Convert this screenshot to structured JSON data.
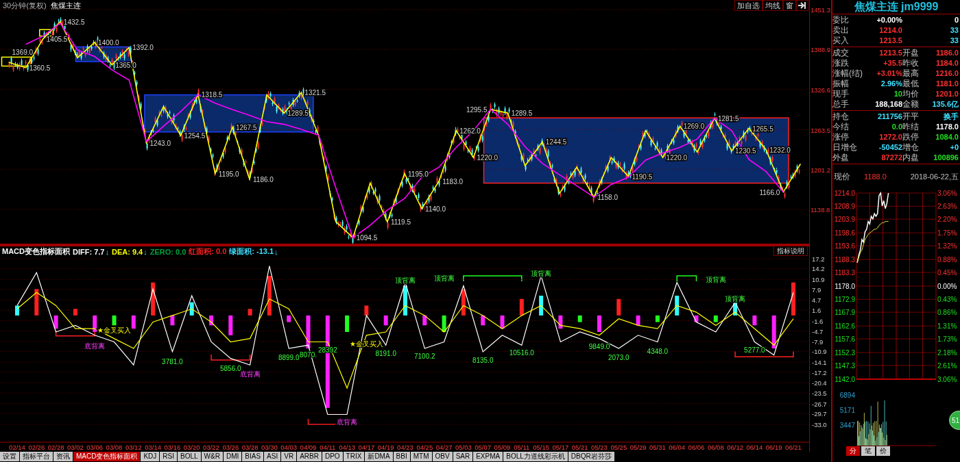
{
  "main_chart": {
    "title": "30分钟(复权)",
    "symbol": "焦煤主连",
    "buttons": [
      "加自选",
      "均线",
      "窗"
    ],
    "chart_data": {
      "type": "line",
      "grid": true,
      "categories": [
        null,
        null,
        null,
        null,
        null,
        null,
        null,
        null,
        null,
        null,
        null,
        null,
        null,
        null,
        null,
        null,
        null,
        null,
        null,
        null,
        null,
        null,
        null,
        null,
        null,
        null,
        null,
        null,
        null,
        null,
        null,
        null,
        null,
        null,
        null,
        null,
        null,
        null,
        null,
        null,
        null,
        null,
        null,
        null,
        null,
        null,
        null
      ],
      "ylim": [
        1083.2,
        1466.3
      ],
      "yticks": [
        {
          "value": 1451.3,
          "label": "1451.3"
        },
        {
          "value": 1388.9,
          "label": "1388.9"
        },
        {
          "value": 1326.6,
          "label": "1326.6"
        },
        {
          "value": 1263.5,
          "label": "1263.5"
        },
        {
          "value": 1201.2,
          "label": "1201.2"
        },
        {
          "value": 1138.8,
          "label": "1138.8"
        }
      ],
      "series": [
        {
          "color": "#ffff00",
          "values": [
            1369,
            1360.5,
            1405.5,
            1432.5,
            1376,
            1400,
            1365,
            1392,
            1243,
            1300,
            1254.5,
            1318.5,
            1195,
            1267.5,
            1186,
            1318,
            1289.5,
            1321.5,
            1255,
            1120,
            1094.5,
            1180,
            1119.5,
            1195,
            1140,
            1183,
            1262,
            1220,
            1295.5,
            1289.5,
            1207,
            1244.5,
            1164,
            1205,
            1158,
            1220,
            1190.5,
            1262,
            1220,
            1269,
            1228.5,
            1281.5,
            1230.5,
            1265.5,
            1232,
            1166,
            1210
          ]
        },
        {
          "color": "#ff00ff",
          "values": [
            null,
            1397,
            1410,
            1430,
            1388,
            1378,
            1357,
            1341,
            1245,
            1269,
            1292,
            1318,
            1305,
            1295,
            1286,
            1276,
            1272,
            1264,
            1255,
            1173,
            1094.5,
            1114,
            1138,
            1156,
            1189,
            1205,
            1236,
            1262,
            1295.5,
            1272,
            1237,
            1211,
            1193,
            1176,
            1158,
            1178,
            1189,
            1216,
            1227,
            1236,
            1249,
            1281.5,
            1262,
            1217,
            1198,
            1166,
            null
          ]
        }
      ],
      "annotations": [
        "1360.5",
        "1369.0",
        "1405.5",
        "1432.5",
        "1400.0",
        "1392.0",
        "1365.0",
        "1318.5",
        "1243.0",
        "1254.5",
        "1267.5",
        "1195.0",
        "1186.0",
        "1321.5",
        "1289.5",
        "1094.5",
        "1119.5",
        "1195.0",
        "1140.0",
        "1183.0",
        "1262.0",
        "1220.0",
        "1295.5",
        "1289.5",
        "1244.5",
        "1158.0",
        "1190.5",
        "1220.0",
        "1269.0",
        "1281.5",
        "1230.5",
        "1265.5",
        "1232.0",
        "1166.0"
      ]
    }
  },
  "macd": {
    "title": "MACD变色指标面积",
    "button": "指标说明",
    "readouts": [
      {
        "text": "DIFF: 7.7",
        "arrow": "↓",
        "color": "#ffffff"
      },
      {
        "text": "DEA: 9.4",
        "arrow": "↓",
        "color": "#ffff00"
      },
      {
        "text": "ZERO: 0.0",
        "color": "#00a040"
      },
      {
        "text": "红面积: 0.0",
        "color": "#ff2020"
      },
      {
        "text": "绿面积: -13.1",
        "arrow": "↓",
        "color": "#40e0ff"
      }
    ],
    "chart_data": {
      "type": "bar",
      "grid": true,
      "categories": [
        "02/14",
        "02/26",
        "02/28",
        "03/02",
        "03/06",
        "03/08",
        "03/12",
        "03/14",
        "03/16",
        "03/20",
        "03/22",
        "03/26",
        "03/28",
        "03/30",
        "04/03",
        "04/09",
        "04/11",
        "04/13",
        "04/17",
        "04/19",
        "04/23",
        "04/25",
        "04/27",
        "05/03",
        "05/07",
        "05/09",
        "05/11",
        "05/15",
        "05/17",
        "05/21",
        "05/23",
        "05/25",
        "05/29",
        "05/31",
        "06/04",
        "06/06",
        "06/08",
        "06/12",
        "06/14",
        "06/19",
        "06/21"
      ],
      "ylim": [
        -38.4,
        21.35
      ],
      "yticks": [
        {
          "value": 17.2,
          "label": "17.2"
        },
        {
          "value": 14.2,
          "label": "14.2"
        },
        {
          "value": 10.9,
          "label": "10.9"
        },
        {
          "value": 7.9,
          "label": "7.9"
        },
        {
          "value": 4.7,
          "label": "4.7"
        },
        {
          "value": 1.6,
          "label": "1.6"
        },
        {
          "value": -1.6,
          "label": "-1.6"
        },
        {
          "value": -4.7,
          "label": "-4.7"
        },
        {
          "value": -7.9,
          "label": "-7.9"
        },
        {
          "value": -10.9,
          "label": "-10.9"
        },
        {
          "value": -14.1,
          "label": "-14.1"
        },
        {
          "value": -17.2,
          "label": "-17.2"
        },
        {
          "value": -20.4,
          "label": "-20.4"
        },
        {
          "value": -23.5,
          "label": "-23.5"
        },
        {
          "value": -26.7,
          "label": "-26.7"
        },
        {
          "value": -29.7,
          "label": "-29.7"
        },
        {
          "value": -33.0,
          "label": "-33.0"
        }
      ],
      "series": [
        {
          "type": "bar",
          "values": [
            3,
            8,
            -4,
            2,
            -5,
            -3,
            -4,
            10,
            -3,
            4,
            -3,
            -6,
            2,
            12,
            -2,
            -10,
            -28,
            -5,
            3,
            -3,
            9,
            -3,
            -5,
            8,
            -3,
            -4,
            5,
            6,
            -4,
            -2,
            -5,
            5,
            -3,
            -2,
            6,
            -2,
            -2,
            4,
            -3,
            -10,
            10
          ],
          "colors": [
            "#30ffff",
            "#ff2020",
            "#ff20ff",
            "#ff2020",
            "#ff20ff",
            "#20ff20",
            "#ff20ff",
            "#ff2020",
            "#ff20ff",
            "#30ffff",
            "#ff20ff",
            "#ff20ff",
            "#ff2020",
            "#ff2020",
            "#ff20ff",
            "#ff20ff",
            "#ff20ff",
            "#20ff20",
            "#ff2020",
            "#ff20ff",
            "#30ffff",
            "#ff20ff",
            "#20ff20",
            "#ff2020",
            "#ff20ff",
            "#ff20ff",
            "#ff2020",
            "#30ffff",
            "#ff20ff",
            "#20ff20",
            "#ff20ff",
            "#ff2020",
            "#ff20ff",
            "#20ff20",
            "#30ffff",
            "#ff20ff",
            "#20ff20",
            "#30ffff",
            "#ff20ff",
            "#ff20ff",
            "#ff2020"
          ]
        },
        {
          "type": "line",
          "color": "#ffffff",
          "values": [
            3,
            13,
            -5,
            -3,
            -6,
            -8,
            -15,
            8,
            -11,
            6,
            -8,
            -13,
            -15,
            15,
            -10,
            -9,
            -30,
            -30,
            0,
            -9,
            10,
            -10,
            -8,
            9,
            -11,
            -6,
            -9,
            12,
            -8,
            -5,
            -7,
            -10,
            -6,
            -8,
            10,
            -2,
            -5,
            4,
            -8,
            -12,
            7
          ]
        },
        {
          "type": "line",
          "color": "#ffff00",
          "values": [
            2,
            7,
            3,
            -4,
            -4,
            -7,
            -10,
            -2,
            0,
            2,
            -2,
            -8,
            -7,
            5,
            2,
            -8,
            -8,
            -22,
            -6,
            -5,
            3,
            0,
            -5,
            3,
            0,
            -4,
            0,
            3,
            -3,
            -4,
            -6,
            -1,
            -3,
            -4,
            3,
            1,
            -3,
            1,
            -4,
            -9,
            -1
          ]
        }
      ],
      "annotations": [
        "★金叉买入",
        "底背离",
        "3781.0",
        "5856.0",
        "底背离",
        "8899.0",
        "8070.",
        "28392",
        "底背离",
        "★金叉买入",
        "8191.0",
        "7100.2",
        "8135.0",
        "10516.0",
        "9849.0",
        "2073.0",
        "4348.0",
        "5277.0",
        "顶背离",
        "顶背离",
        "顶背离",
        "顶背离",
        "顶背离"
      ]
    }
  },
  "tabs": [
    {
      "label": "设置",
      "selected": false
    },
    {
      "label": "指标平台",
      "selected": false
    },
    {
      "label": "资讯",
      "selected": false
    },
    {
      "label": "MACD变色指标面积",
      "selected": true
    },
    {
      "label": "KDJ",
      "selected": false
    },
    {
      "label": "RSI",
      "selected": false
    },
    {
      "label": "BOLL",
      "selected": false
    },
    {
      "label": "W&R",
      "selected": false
    },
    {
      "label": "DMI",
      "selected": false
    },
    {
      "label": "BIAS",
      "selected": false
    },
    {
      "label": "ASI",
      "selected": false
    },
    {
      "label": "VR",
      "selected": false
    },
    {
      "label": "ARBR",
      "selected": false
    },
    {
      "label": "DPO",
      "selected": false
    },
    {
      "label": "TRIX",
      "selected": false
    },
    {
      "label": "新DMA",
      "selected": false
    },
    {
      "label": "BBI",
      "selected": false
    },
    {
      "label": "MTM",
      "selected": false
    },
    {
      "label": "OBV",
      "selected": false
    },
    {
      "label": "SAR",
      "selected": false
    },
    {
      "label": "EXPMA",
      "selected": false
    },
    {
      "label": "BOLL力道线彩示机",
      "selected": false
    },
    {
      "label": "DBQR岩芬莎",
      "selected": false
    }
  ],
  "quote": {
    "title": "焦煤主连 jm9999",
    "sections": [
      [
        {
          "label": "委比",
          "value": {
            "text": "+0.00%",
            "color": "#ffffff"
          },
          "value2": {
            "text": "0",
            "color": "#ffffff"
          }
        },
        {
          "label": "卖出",
          "value": {
            "text": "1214.0",
            "color": "#ff3030"
          },
          "value2": {
            "text": "33",
            "color": "#40e0ff"
          }
        },
        {
          "label": "买入",
          "value": {
            "text": "1213.5",
            "color": "#ff3030"
          },
          "value2": {
            "text": "33",
            "color": "#40e0ff"
          }
        }
      ],
      [
        {
          "label": "成交",
          "value": {
            "text": "1213.5",
            "color": "#ff3030"
          },
          "label2": "开盘",
          "value2": {
            "text": "1186.0",
            "color": "#ff3030"
          }
        },
        {
          "label": "涨跌",
          "value": {
            "text": "+35.5",
            "color": "#ff3030"
          },
          "label2": "昨收",
          "value2": {
            "text": "1184.0",
            "color": "#ff3030"
          }
        },
        {
          "label": "涨幅(结)",
          "value": {
            "text": "+3.01%",
            "color": "#ff3030"
          },
          "label2": "最高",
          "value2": {
            "text": "1216.0",
            "color": "#ff3030"
          }
        },
        {
          "label": "振幅",
          "value": {
            "text": "2.96%",
            "color": "#40e0ff"
          },
          "label2": "最低",
          "value2": {
            "text": "1181.0",
            "color": "#ff3030"
          }
        },
        {
          "label": "现手",
          "value": {
            "text": "10",
            "color": "#20e020"
          },
          "label2": "均价",
          "value2": {
            "text": "1201.0",
            "color": "#ff3030"
          }
        },
        {
          "label": "总手",
          "value": {
            "text": "188,168",
            "color": "#ffffff"
          },
          "label2": "金额",
          "value2": {
            "text": "135.6亿",
            "color": "#40e0ff"
          }
        }
      ],
      [
        {
          "label": "持仓",
          "value": {
            "text": "211756",
            "color": "#40e0ff"
          },
          "label2": "开平",
          "value2": {
            "text": "换手",
            "color": "#40e0ff"
          }
        },
        {
          "label": "今结",
          "value": {
            "text": "0.0",
            "color": "#20e020"
          },
          "label2": "昨结",
          "value2": {
            "text": "1178.0",
            "color": "#ffffff"
          }
        },
        {
          "label": "涨停",
          "value": {
            "text": "1272.0",
            "color": "#ff3030"
          },
          "label2": "跌停",
          "value2": {
            "text": "1084.0",
            "color": "#20e020"
          }
        },
        {
          "label": "日增仓",
          "value": {
            "text": "-50452",
            "color": "#40e0ff"
          },
          "label2": "增仓",
          "value2": {
            "text": "+0",
            "color": "#40e0ff"
          }
        },
        {
          "label": "外盘",
          "value": {
            "text": "87272",
            "color": "#ff3030"
          },
          "label2": "内盘",
          "value2": {
            "text": "100896",
            "color": "#20e020"
          }
        }
      ]
    ],
    "price_label": "现价",
    "price": "1188.0",
    "date": "2018-06-22,五"
  },
  "intraday": {
    "chart_data": {
      "type": "line",
      "grid": true,
      "categories": [
        null,
        null,
        null,
        null,
        null,
        null,
        null,
        null,
        null,
        null,
        null,
        null,
        null,
        null,
        null,
        null,
        null,
        null,
        null,
        null,
        null,
        null,
        null,
        null,
        null,
        null,
        null,
        null,
        null,
        null,
        null,
        null,
        null,
        null,
        null,
        null,
        null,
        null,
        null,
        null,
        null,
        null,
        null,
        null,
        null,
        null,
        null,
        null,
        null,
        null,
        null
      ],
      "ylim": [
        1142,
        1214
      ],
      "yticks": [
        {
          "value": 1214,
          "label": "1214.0"
        },
        {
          "value": 1208.9,
          "label": "1208.9"
        },
        {
          "value": 1203.9,
          "label": "1203.9"
        },
        {
          "value": 1198.6,
          "label": "1198.6"
        },
        {
          "value": 1193.6,
          "label": "1193.6"
        },
        {
          "value": 1188.3,
          "label": "1188.3"
        },
        {
          "value": 1183.3,
          "label": "1183.3"
        },
        {
          "value": 1178,
          "label": "1178.0"
        },
        {
          "value": 1172.9,
          "label": "1172.9"
        },
        {
          "value": 1167.9,
          "label": "1167.9"
        },
        {
          "value": 1162.6,
          "label": "1162.6"
        },
        {
          "value": 1157.6,
          "label": "1157.6"
        },
        {
          "value": 1152.3,
          "label": "1152.3"
        },
        {
          "value": 1147.3,
          "label": "1147.3"
        },
        {
          "value": 1142,
          "label": "1142.0"
        }
      ],
      "series": [
        {
          "color": "#ffffff",
          "values": [
            1187,
            1190,
            1192,
            1196,
            1195,
            1199,
            1200,
            1203,
            1202,
            1205,
            1204,
            1206,
            1205,
            1206,
            1213,
            1214,
            1209,
            1211,
            1208,
            1210,
            1214,
            null,
            null,
            null,
            null,
            null,
            null,
            null,
            null,
            null,
            null,
            null,
            null,
            null,
            null,
            null,
            null,
            null,
            null,
            null,
            null,
            null,
            null,
            null,
            null,
            null,
            null,
            null,
            null,
            null,
            null
          ]
        },
        {
          "color": "#e0e040",
          "values": [
            1187,
            1189,
            1191,
            1192,
            1194,
            1196,
            1197,
            1198,
            1198.5,
            1199,
            1199.5,
            1200,
            1200,
            1200.5,
            1201.5,
            1202,
            1202.5,
            1202.5,
            1203,
            1203,
            1203,
            null,
            null,
            null,
            null,
            null,
            null,
            null,
            null,
            null,
            null,
            null,
            null,
            null,
            null,
            null,
            null,
            null,
            null,
            null,
            null,
            null,
            null,
            null,
            null,
            null,
            null,
            null,
            null,
            null,
            null
          ]
        }
      ]
    },
    "percent_labels": [
      "3.06%",
      "2.63%",
      "2.20%",
      "1.75%",
      "1.32%",
      "0.88%",
      "0.45%",
      "0.00%",
      "0.43%",
      "0.86%",
      "1.31%",
      "1.73%",
      "2.18%",
      "2.61%",
      "3.06%"
    ],
    "volume_labels": [
      "6894",
      "5171",
      "3447"
    ],
    "tabs": [
      {
        "label": "分",
        "selected": true
      },
      {
        "label": "笔",
        "selected": false
      },
      {
        "label": "价",
        "selected": false
      }
    ]
  },
  "float_badge": "51"
}
